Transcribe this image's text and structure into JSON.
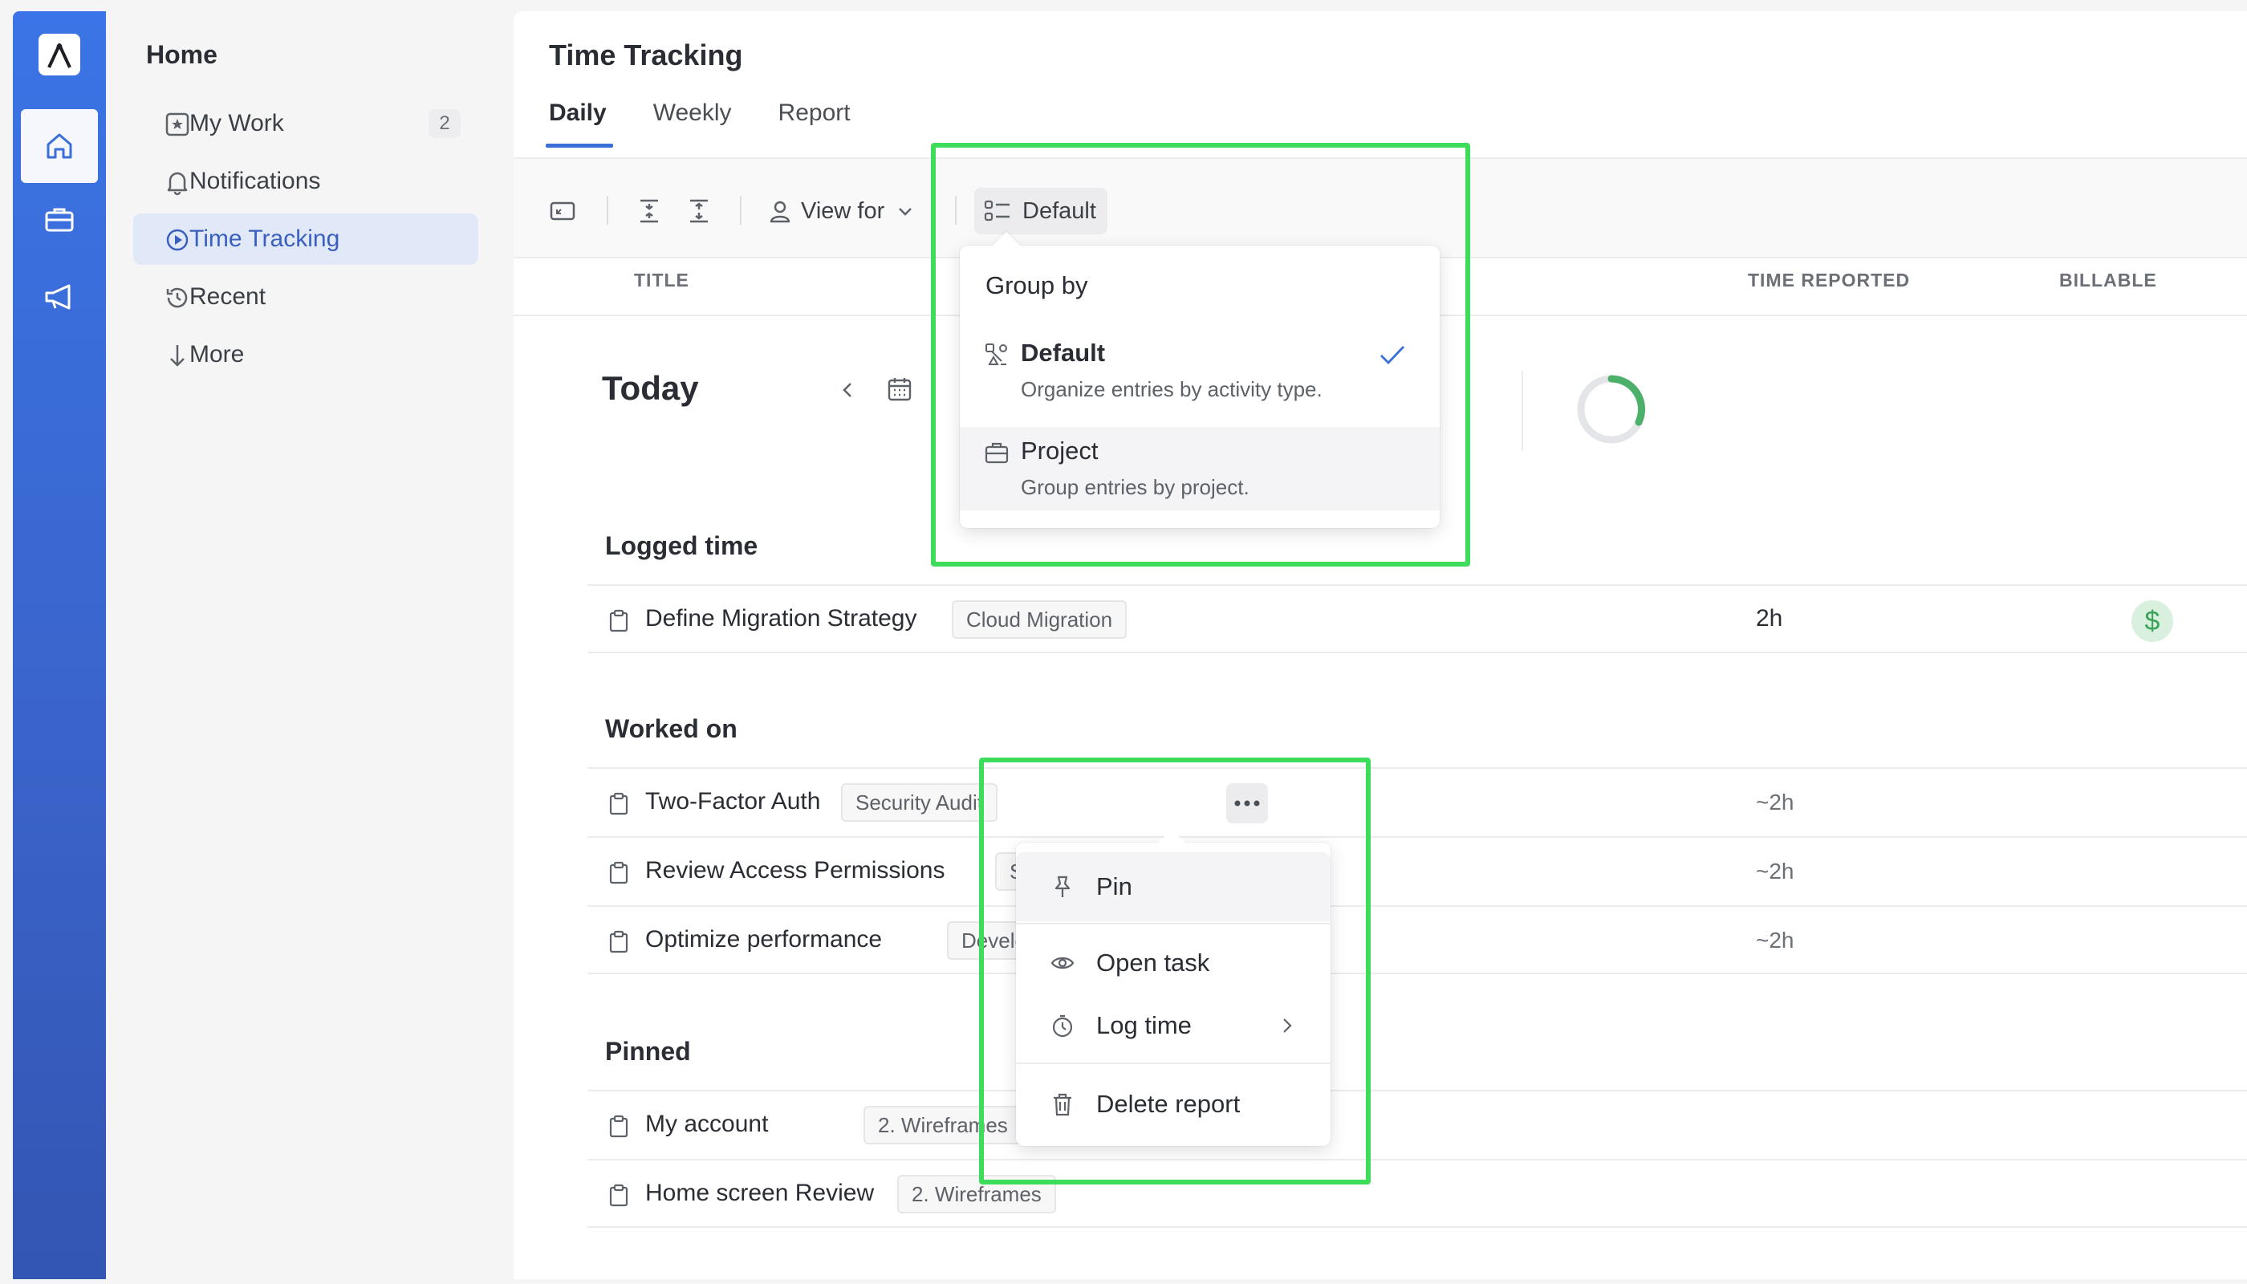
{
  "sidebar": {
    "title": "Home",
    "items": [
      {
        "label": "My Work",
        "badge": "2",
        "icon": "star-square-icon"
      },
      {
        "label": "Notifications",
        "icon": "bell-icon"
      },
      {
        "label": "Time Tracking",
        "icon": "clock-play-icon",
        "active": true
      },
      {
        "label": "Recent",
        "icon": "history-icon"
      },
      {
        "label": "More",
        "icon": "arrow-down-icon"
      }
    ]
  },
  "rail": {
    "items": [
      "home-icon",
      "briefcase-icon",
      "megaphone-icon"
    ]
  },
  "header": {
    "title": "Time Tracking",
    "tabs": [
      {
        "label": "Daily",
        "active": true
      },
      {
        "label": "Weekly"
      },
      {
        "label": "Report"
      }
    ]
  },
  "toolbar": {
    "view_for_label": "View for",
    "group_label": "Default"
  },
  "table": {
    "columns": {
      "title": "TITLE",
      "time": "TIME REPORTED",
      "billable": "BILLABLE"
    }
  },
  "day": {
    "label": "Today"
  },
  "sections": {
    "logged": {
      "title": "Logged time",
      "rows": [
        {
          "task": "Define Migration Strategy",
          "tag": "Cloud Migration",
          "time": "2h",
          "billable": "$"
        }
      ]
    },
    "worked": {
      "title": "Worked on",
      "rows": [
        {
          "task": "Two-Factor Auth",
          "tag": "Security Audit",
          "time": "~2h"
        },
        {
          "task": "Review Access Permissions",
          "tag": "Sec",
          "time": "~2h"
        },
        {
          "task": "Optimize performance",
          "tag": "Develop",
          "time": "~2h"
        }
      ]
    },
    "pinned": {
      "title": "Pinned",
      "rows": [
        {
          "task": "My account",
          "tag": "2. Wireframes"
        },
        {
          "task": "Home screen Review",
          "tag": "2. Wireframes"
        }
      ]
    }
  },
  "group_by_menu": {
    "title": "Group by",
    "options": [
      {
        "label": "Default",
        "description": "Organize entries by activity type.",
        "selected": true
      },
      {
        "label": "Project",
        "description": "Group entries by project."
      }
    ]
  },
  "context_menu": {
    "items": [
      {
        "label": "Pin",
        "icon": "pin-icon"
      },
      {
        "label": "Open task",
        "icon": "eye-icon"
      },
      {
        "label": "Log time",
        "icon": "stopwatch-icon"
      },
      {
        "label": "Delete report",
        "icon": "trash-icon"
      }
    ]
  },
  "colors": {
    "accent": "#3a6fd8",
    "highlight": "#3ddc5a",
    "billable": "#3aa35a"
  }
}
